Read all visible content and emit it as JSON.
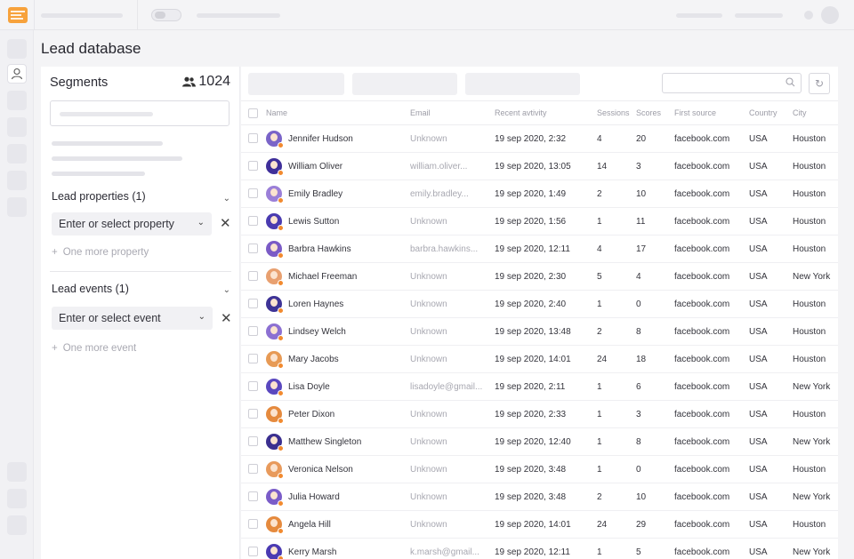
{
  "page": {
    "title": "Lead database"
  },
  "segments": {
    "title": "Segments",
    "count": "1024",
    "lead_properties": {
      "label": "Lead properties (1)",
      "select_placeholder": "Enter or select property",
      "add_more": "One more property"
    },
    "lead_events": {
      "label": "Lead events (1)",
      "select_placeholder": "Enter or select event",
      "add_more": "One more event"
    }
  },
  "table": {
    "columns": [
      "Name",
      "Email",
      "Recent avtivity",
      "Sessions",
      "Scores",
      "First source",
      "Country",
      "City"
    ],
    "rows": [
      {
        "name": "Jennifer Hudson",
        "email": "Unknown",
        "activity": "19 sep 2020, 2:32",
        "sessions": "4",
        "scores": "20",
        "source": "facebook.com",
        "country": "USA",
        "city": "Houston",
        "avatar_color": "#7a64c8"
      },
      {
        "name": "William Oliver",
        "email": "william.oliver...",
        "activity": "19 sep 2020, 13:05",
        "sessions": "14",
        "scores": "3",
        "source": "facebook.com",
        "country": "USA",
        "city": "Houston",
        "avatar_color": "#3f2f9a"
      },
      {
        "name": "Emily Bradley",
        "email": "emily.bradley...",
        "activity": "19 sep 2020, 1:49",
        "sessions": "2",
        "scores": "10",
        "source": "facebook.com",
        "country": "USA",
        "city": "Houston",
        "avatar_color": "#9b7fd8"
      },
      {
        "name": "Lewis Sutton",
        "email": "Unknown",
        "activity": "19 sep 2020, 1:56",
        "sessions": "1",
        "scores": "11",
        "source": "facebook.com",
        "country": "USA",
        "city": "Houston",
        "avatar_color": "#4a3bb0"
      },
      {
        "name": "Barbra Hawkins",
        "email": "barbra.hawkins...",
        "activity": "19 sep 2020, 12:11",
        "sessions": "4",
        "scores": "17",
        "source": "facebook.com",
        "country": "USA",
        "city": "Houston",
        "avatar_color": "#7b5bc6"
      },
      {
        "name": "Michael Freeman",
        "email": "Unknown",
        "activity": "19 sep 2020, 2:30",
        "sessions": "5",
        "scores": "4",
        "source": "facebook.com",
        "country": "USA",
        "city": "New York",
        "avatar_color": "#e8a070"
      },
      {
        "name": "Loren Haynes",
        "email": "Unknown",
        "activity": "19 sep 2020, 2:40",
        "sessions": "1",
        "scores": "0",
        "source": "facebook.com",
        "country": "USA",
        "city": "Houston",
        "avatar_color": "#3e3396"
      },
      {
        "name": "Lindsey Welch",
        "email": "Unknown",
        "activity": "19 sep 2020, 13:48",
        "sessions": "2",
        "scores": "8",
        "source": "facebook.com",
        "country": "USA",
        "city": "Houston",
        "avatar_color": "#8c70d2"
      },
      {
        "name": "Mary Jacobs",
        "email": "Unknown",
        "activity": "19 sep 2020, 14:01",
        "sessions": "24",
        "scores": "18",
        "source": "facebook.com",
        "country": "USA",
        "city": "Houston",
        "avatar_color": "#e79a55"
      },
      {
        "name": "Lisa Doyle",
        "email": "lisadoyle@gmail...",
        "activity": "19 sep 2020, 2:11",
        "sessions": "1",
        "scores": "6",
        "source": "facebook.com",
        "country": "USA",
        "city": "New York",
        "avatar_color": "#5a48bf"
      },
      {
        "name": "Peter Dixon",
        "email": "Unknown",
        "activity": "19 sep 2020, 2:33",
        "sessions": "1",
        "scores": "3",
        "source": "facebook.com",
        "country": "USA",
        "city": "Houston",
        "avatar_color": "#e58a3e"
      },
      {
        "name": "Matthew Singleton",
        "email": "Unknown",
        "activity": "19 sep 2020, 12:40",
        "sessions": "1",
        "scores": "8",
        "source": "facebook.com",
        "country": "USA",
        "city": "New York",
        "avatar_color": "#3b2f8f"
      },
      {
        "name": "Veronica Nelson",
        "email": "Unknown",
        "activity": "19 sep 2020, 3:48",
        "sessions": "1",
        "scores": "0",
        "source": "facebook.com",
        "country": "USA",
        "city": "Houston",
        "avatar_color": "#e89a5c"
      },
      {
        "name": "Julia Howard",
        "email": "Unknown",
        "activity": "19 sep 2020, 3:48",
        "sessions": "2",
        "scores": "10",
        "source": "facebook.com",
        "country": "USA",
        "city": "New York",
        "avatar_color": "#7a5cc8"
      },
      {
        "name": "Angela Hill",
        "email": "Unknown",
        "activity": "19 sep 2020, 14:01",
        "sessions": "24",
        "scores": "29",
        "source": "facebook.com",
        "country": "USA",
        "city": "Houston",
        "avatar_color": "#e58a3e"
      },
      {
        "name": "Kerry Marsh",
        "email": "k.marsh@gmail...",
        "activity": "19 sep 2020, 12:11",
        "sessions": "1",
        "scores": "5",
        "source": "facebook.com",
        "country": "USA",
        "city": "New York",
        "avatar_color": "#4b3ab2"
      }
    ]
  },
  "colors": {
    "accent": "#f28a2f",
    "badge": "#f28a2f"
  },
  "icons": {
    "logo": "app-logo-icon",
    "users": "users-icon",
    "search": "search-icon",
    "refresh": "refresh-icon",
    "close": "close-icon",
    "plus": "plus-icon",
    "chevron": "chevron-down-icon"
  }
}
